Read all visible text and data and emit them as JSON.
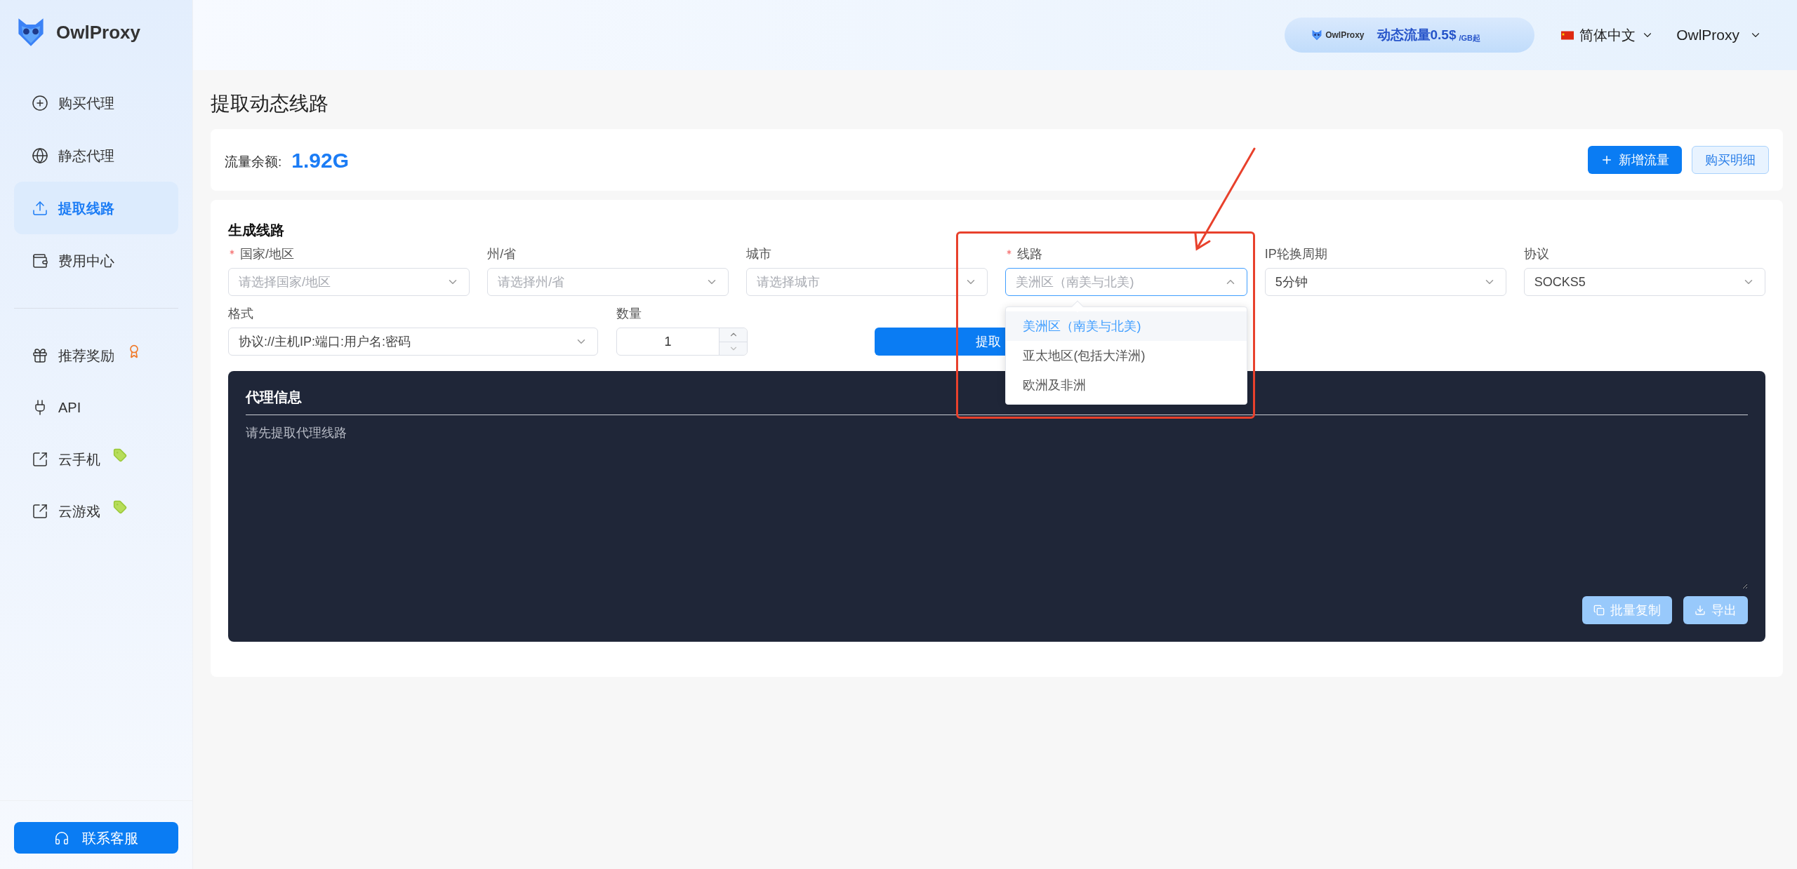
{
  "brand": {
    "name": "OwlProxy"
  },
  "sidebar": {
    "items": [
      {
        "label": "购买代理",
        "selected": false
      },
      {
        "label": "静态代理",
        "selected": false
      },
      {
        "label": "提取线路",
        "selected": true
      },
      {
        "label": "费用中心",
        "selected": false
      }
    ],
    "extra_items": [
      {
        "label": "推荐奖励",
        "kind": "award"
      },
      {
        "label": "API",
        "kind": "plain"
      },
      {
        "label": "云手机",
        "kind": "sale"
      },
      {
        "label": "云游戏",
        "kind": "sale"
      }
    ],
    "support_button": "联系客服"
  },
  "header": {
    "promo": {
      "brand": "OwlProxy",
      "text": "动态流量0.5$",
      "unit": "/GB起"
    },
    "language": "简体中文",
    "user": "OwlProxy"
  },
  "page_title": "提取动态线路",
  "balance": {
    "label": "流量余额:",
    "value": "1.92G",
    "buttons": [
      {
        "label": "新增流量",
        "kind": "primary"
      },
      {
        "label": "购买明细",
        "kind": "plain"
      }
    ]
  },
  "generate": {
    "title": "生成线路",
    "rows": [
      [
        {
          "kind": "select",
          "label": "国家/地区",
          "required": true,
          "placeholder": "请选择国家/地区",
          "open": false
        },
        {
          "kind": "select",
          "label": "州/省",
          "required": false,
          "placeholder": "请选择州/省",
          "open": false
        },
        {
          "kind": "select",
          "label": "城市",
          "required": false,
          "placeholder": "请选择城市",
          "open": false
        },
        {
          "kind": "select",
          "label": "线路",
          "required": true,
          "value": "美洲区（南美与北美)",
          "open": true,
          "options": [
            {
              "label": "美洲区（南美与北美)",
              "selected": true
            },
            {
              "label": "亚太地区(包括大洋洲)",
              "selected": false
            },
            {
              "label": "欧洲及非洲",
              "selected": false
            }
          ]
        },
        {
          "kind": "select",
          "label": "IP轮换周期",
          "required": false,
          "value": "5分钟",
          "open": false
        },
        {
          "kind": "select",
          "label": "协议",
          "required": false,
          "value": "SOCKS5",
          "open": false
        }
      ],
      [
        {
          "kind": "select",
          "label": "格式",
          "required": false,
          "value": "协议://主机IP:端口:用户名:密码",
          "open": false
        },
        {
          "kind": "number",
          "label": "数量",
          "required": false,
          "value": "1"
        }
      ]
    ],
    "extract_button": "提取"
  },
  "proxy_info": {
    "title": "代理信息",
    "placeholder": "请先提取代理线路",
    "buttons": [
      {
        "label": "批量复制",
        "kind": "copy",
        "disabled": true
      },
      {
        "label": "导出",
        "kind": "export",
        "disabled": true
      }
    ]
  }
}
